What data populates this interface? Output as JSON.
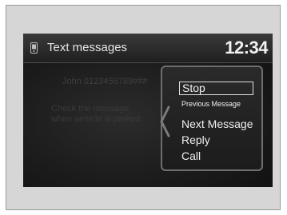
{
  "screen": {
    "title": "Text messages",
    "clock": "12:34",
    "message_sender": "John 0123456789###",
    "notice_line1": "Check the message",
    "notice_line2": "when vehicle is parked."
  },
  "menu": {
    "items": [
      {
        "label": "Stop",
        "selected": true
      },
      {
        "label": "Previous Message"
      },
      {
        "label": "Next Message"
      },
      {
        "label": "Reply"
      },
      {
        "label": "Call"
      }
    ]
  },
  "icons": {
    "header": "phone-icon",
    "menu_tab": "chevron-left-icon"
  },
  "colors": {
    "screen_bg": "#1b1b1b",
    "text": "#f0f0f0",
    "frame_bg": "#d6d6d6"
  }
}
